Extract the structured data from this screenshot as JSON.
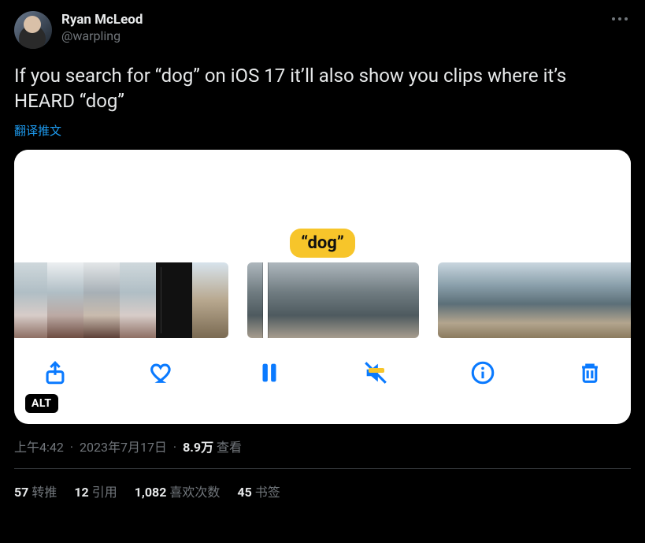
{
  "author": {
    "display_name": "Ryan McLeod",
    "handle": "@warpling"
  },
  "tweet_text": "If you search for “dog” on iOS 17 it’ll also show you clips where it’s HEARD “dog”",
  "translate_label": "翻译推文",
  "media": {
    "caption_bubble": "“dog”",
    "alt_badge": "ALT"
  },
  "meta": {
    "time": "上午4:42",
    "date": "2023年7月17日",
    "views_count": "8.9万",
    "views_label": "查看"
  },
  "stats": {
    "retweets_count": "57",
    "retweets_label": "转推",
    "quotes_count": "12",
    "quotes_label": "引用",
    "likes_count": "1,082",
    "likes_label": "喜欢次数",
    "bookmarks_count": "45",
    "bookmarks_label": "书签"
  }
}
